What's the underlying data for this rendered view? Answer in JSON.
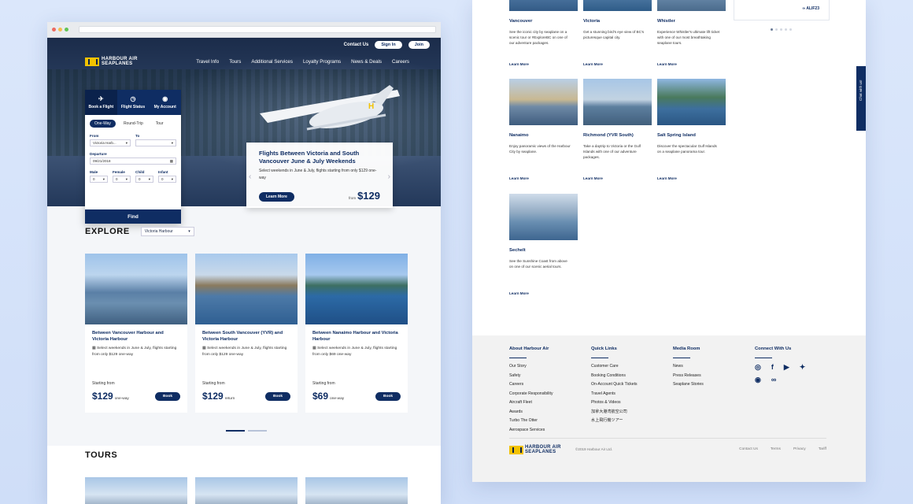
{
  "topbar": {
    "contact": "Contact Us",
    "signin": "Sign In",
    "join": "Join"
  },
  "brand": {
    "line1": "HARBOUR AIR",
    "line2": "SEAPLANES"
  },
  "nav": [
    "Travel Info",
    "Tours",
    "Additional Services",
    "Loyalty Programs",
    "News & Deals",
    "Careers"
  ],
  "booking": {
    "tabs": [
      {
        "label": "Book a Flight",
        "icon": "plane-icon"
      },
      {
        "label": "Flight Status",
        "icon": "clock-icon"
      },
      {
        "label": "My Account",
        "icon": "user-icon"
      }
    ],
    "trip_types": [
      "One-Way",
      "Round-Trip",
      "Tour"
    ],
    "from_label": "From",
    "from_value": "Victoria Harb...",
    "to_label": "To",
    "to_value": "",
    "departure_label": "Departure",
    "departure_value": "09/21/2018",
    "pax": [
      {
        "label": "Male",
        "value": "0"
      },
      {
        "label": "Female",
        "value": "0"
      },
      {
        "label": "Child",
        "value": "0"
      },
      {
        "label": "Infant",
        "value": "0"
      }
    ],
    "find": "Find"
  },
  "promo": {
    "title": "Flights Between Victoria and South Vancouver June & July Weekends",
    "desc": "Select weekends in June & July, flights starting from only $129 one-way",
    "learn": "Learn More",
    "from": "from",
    "price": "$129"
  },
  "explore": {
    "title": "EXPLORE",
    "select": "Victoria Harbour",
    "cards": [
      {
        "title": "Between Vancouver Harbour and Victoria Harbour",
        "desc": "Select weekends in June & July, flights starting from only $129 one-way",
        "from": "Starting from",
        "price": "$129",
        "unit": "one-way",
        "book": "Book"
      },
      {
        "title": "Between South Vancouver (YVR) and Victoria Harbour",
        "desc": "Select weekends in June & July, flights starting from only $129 one-way",
        "from": "Starting from",
        "price": "$129",
        "unit": "return",
        "book": "Book"
      },
      {
        "title": "Between Nanaimo Harbour and Victoria Harbour",
        "desc": "Select weekends in June & July, flights starting from only $69 one-way",
        "from": "Starting from",
        "price": "$69",
        "unit": "one-way",
        "book": "Book"
      }
    ]
  },
  "tours": {
    "title": "TOURS"
  },
  "destinations": [
    {
      "name": "Vancouver",
      "desc": "See the iconic city by seaplane on a scenic tour or #ExploreBC on one of our adventure packages.",
      "more": "Learn More"
    },
    {
      "name": "Victoria",
      "desc": "Get a stunning bird's eye view of BC's picturesque capital city.",
      "more": "Learn More"
    },
    {
      "name": "Whistler",
      "desc": "Experience Whistler's ultimate lift ticket with one of our most breathtaking seaplane tours.",
      "more": "Learn More"
    },
    {
      "name": "Nanaimo",
      "desc": "Enjoy panoramic views of the Harbour City by seaplane.",
      "more": "Learn More"
    },
    {
      "name": "Richmond (YVR South)",
      "desc": "Take a daytrip to Victoria or the Gulf Islands with one of our adventure packages.",
      "more": "Learn More"
    },
    {
      "name": "Salt Spring Island",
      "desc": "Discover the spectacular Gulf Islands on a seaplane panorama tour.",
      "more": "Learn More"
    },
    {
      "name": "Sechelt",
      "desc": "See the Sunshine Coast from above on one of our scenic aerial tours.",
      "more": "Learn More"
    }
  ],
  "side": {
    "badge": "ALIF23"
  },
  "chat": {
    "label": "Chat with us!"
  },
  "footer": {
    "about": {
      "title": "About Harbour Air",
      "links": [
        "Our Story",
        "Safety",
        "Careers",
        "Corporate Responsibility",
        "Aircraft Fleet",
        "Awards",
        "Turbo The Otter",
        "Aerospace Services"
      ]
    },
    "quick": {
      "title": "Quick Links",
      "links": [
        "Customer Care",
        "Booking Conditions",
        "On-Account Quick Tickets",
        "Travel Agents",
        "Photos & Videos",
        "加拿大港湾航空公司",
        "水上飛行機ツアー"
      ]
    },
    "media": {
      "title": "Media Room",
      "links": [
        "News",
        "Press Releases",
        "Seaplane Stories"
      ]
    },
    "connect": {
      "title": "Connect With Us",
      "icons": [
        "instagram-icon",
        "facebook-icon",
        "youtube-icon",
        "twitter-icon",
        "weibo-icon",
        "tripadvisor-icon"
      ]
    },
    "copyright": "©2019 Harbour Air Ltd.",
    "bottom_links": [
      "Contact Us",
      "Terms",
      "Privacy",
      "Tariff"
    ]
  }
}
